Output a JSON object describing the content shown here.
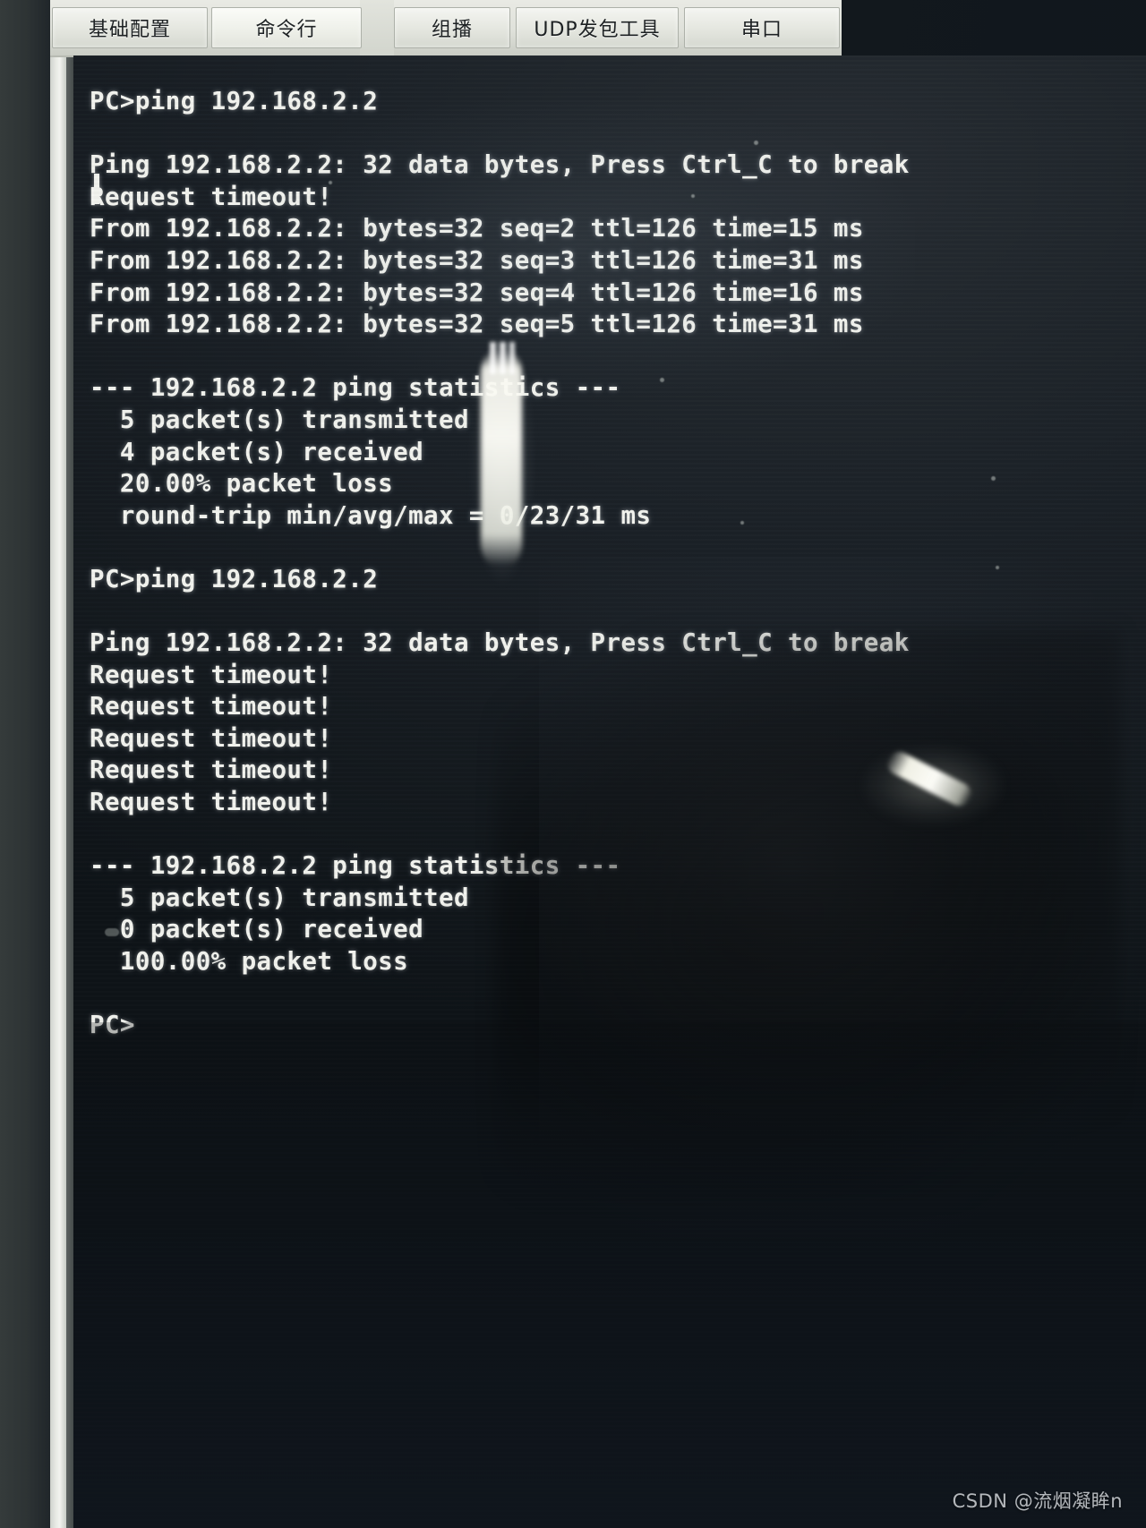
{
  "window": {
    "kind": "ensp-pc-terminal-photo",
    "tabs": [
      {
        "id": "basic-config",
        "label": "基础配置",
        "selected": false
      },
      {
        "id": "command-line",
        "label": "命令行",
        "selected": true
      },
      {
        "id": "multicast",
        "label": "组播",
        "selected": false
      },
      {
        "id": "udp-tool",
        "label": "UDP发包工具",
        "selected": false
      },
      {
        "id": "serial-port",
        "label": "串口",
        "selected": false
      }
    ]
  },
  "terminal": {
    "prompt": "PC>",
    "target_host": "192.168.2.2",
    "lines": [
      "PC>ping 192.168.2.2",
      "",
      "Ping 192.168.2.2: 32 data bytes, Press Ctrl_C to break",
      "Request timeout!",
      "From 192.168.2.2: bytes=32 seq=2 ttl=126 time=15 ms",
      "From 192.168.2.2: bytes=32 seq=3 ttl=126 time=31 ms",
      "From 192.168.2.2: bytes=32 seq=4 ttl=126 time=16 ms",
      "From 192.168.2.2: bytes=32 seq=5 ttl=126 time=31 ms",
      "",
      "--- 192.168.2.2 ping statistics ---",
      "  5 packet(s) transmitted",
      "  4 packet(s) received",
      "  20.00% packet loss",
      "  round-trip min/avg/max = 0/23/31 ms",
      "",
      "PC>ping 192.168.2.2",
      "",
      "Ping 192.168.2.2: 32 data bytes, Press Ctrl_C to break",
      "Request timeout!",
      "Request timeout!",
      "Request timeout!",
      "Request timeout!",
      "Request timeout!",
      "",
      "--- 192.168.2.2 ping statistics ---",
      "  5 packet(s) transmitted",
      "  0 packet(s) received",
      "  100.00% packet loss",
      "",
      "PC>"
    ],
    "ping_results": [
      {
        "command": "ping 192.168.2.2",
        "header": "Ping 192.168.2.2: 32 data bytes, Press Ctrl_C to break",
        "replies": [
          {
            "status": "Request timeout!"
          },
          {
            "from": "192.168.2.2",
            "bytes": 32,
            "seq": 2,
            "ttl": 126,
            "time_ms": 15
          },
          {
            "from": "192.168.2.2",
            "bytes": 32,
            "seq": 3,
            "ttl": 126,
            "time_ms": 31
          },
          {
            "from": "192.168.2.2",
            "bytes": 32,
            "seq": 4,
            "ttl": 126,
            "time_ms": 16
          },
          {
            "from": "192.168.2.2",
            "bytes": 32,
            "seq": 5,
            "ttl": 126,
            "time_ms": 31
          }
        ],
        "statistics_title": "--- 192.168.2.2 ping statistics ---",
        "transmitted": "5 packet(s) transmitted",
        "received": "4 packet(s) received",
        "loss": "20.00% packet loss",
        "round_trip": "round-trip min/avg/max = 0/23/31 ms"
      },
      {
        "command": "ping 192.168.2.2",
        "header": "Ping 192.168.2.2: 32 data bytes, Press Ctrl_C to break",
        "replies": [
          {
            "status": "Request timeout!"
          },
          {
            "status": "Request timeout!"
          },
          {
            "status": "Request timeout!"
          },
          {
            "status": "Request timeout!"
          },
          {
            "status": "Request timeout!"
          }
        ],
        "statistics_title": "--- 192.168.2.2 ping statistics ---",
        "transmitted": "5 packet(s) transmitted",
        "received": "0 packet(s) received",
        "loss": "100.00% packet loss",
        "round_trip": ""
      }
    ]
  },
  "watermark": {
    "text": "CSDN @流烟凝眸n"
  },
  "colors": {
    "terminal_bg": "#0e1317",
    "terminal_fg": "#f2f3ee",
    "tabbar_bg": "#e2e4dd",
    "tab_face": "#edefe8",
    "tab_border": "#adb1a9",
    "bezel": "#2d3334"
  }
}
